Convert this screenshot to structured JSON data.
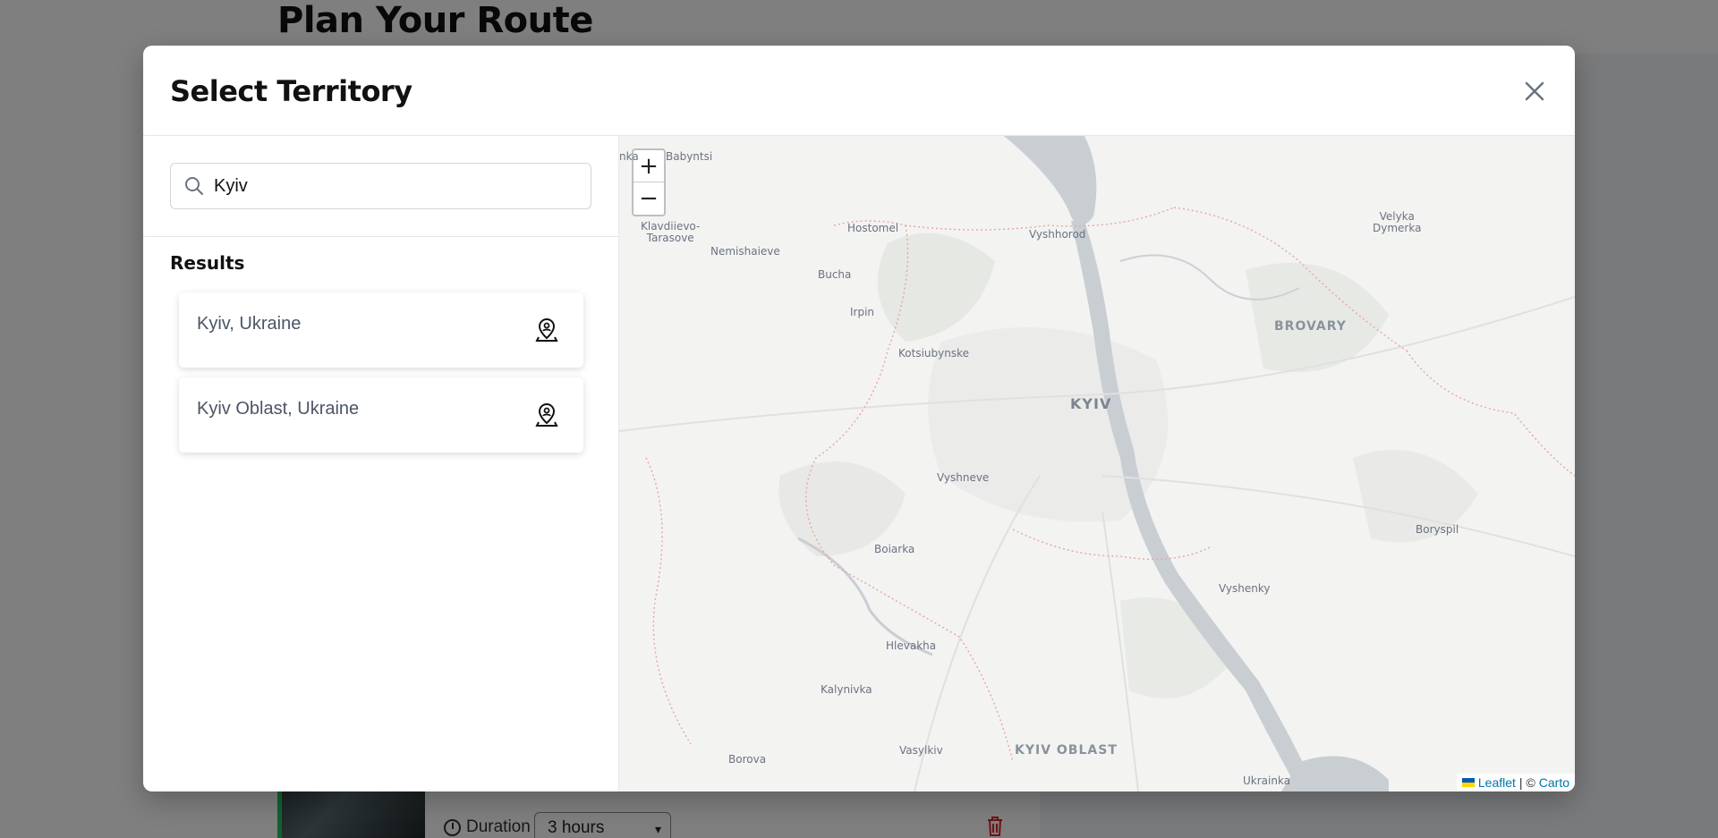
{
  "background": {
    "page_title": "Plan Your Route",
    "duration_label": "Duration",
    "duration_value": "3 hours"
  },
  "modal": {
    "title": "Select Territory",
    "search": {
      "value": "Kyiv",
      "placeholder": ""
    },
    "results_title": "Results",
    "results": [
      {
        "label": "Kyiv, Ukraine",
        "icon": "map-pin-person-icon"
      },
      {
        "label": "Kyiv Oblast, Ukraine",
        "icon": "map-pin-person-icon"
      }
    ]
  },
  "map": {
    "zoom_in": "+",
    "zoom_out": "−",
    "labels": {
      "babyntsi": "Babyntsi",
      "klavdiievo": "Klavdiievo-\nTarasove",
      "nemishaieve": "Nemishaieve",
      "hostomel": "Hostomel",
      "bucha": "Bucha",
      "irpin": "Irpin",
      "kotsiubynske": "Kotsiubynske",
      "vyshhorod": "Vyshhorod",
      "velyka": "Velyka\nDymerka",
      "brovary": "BROVARY",
      "kyiv": "KYIV",
      "vyshneve": "Vyshneve",
      "boiarka": "Boiarka",
      "boryspil": "Boryspil",
      "vyshenky": "Vyshenky",
      "hlevakha": "Hlevakha",
      "kalynivka": "Kalynivka",
      "borova": "Borova",
      "vasylkiv": "Vasylkiv",
      "kyiv_oblast": "KYIV OBLAST",
      "ukrainka": "Ukrainka",
      "nka": "nka"
    },
    "attribution": {
      "leaflet": "Leaflet",
      "separator": "| ©",
      "carto": "Carto"
    }
  }
}
